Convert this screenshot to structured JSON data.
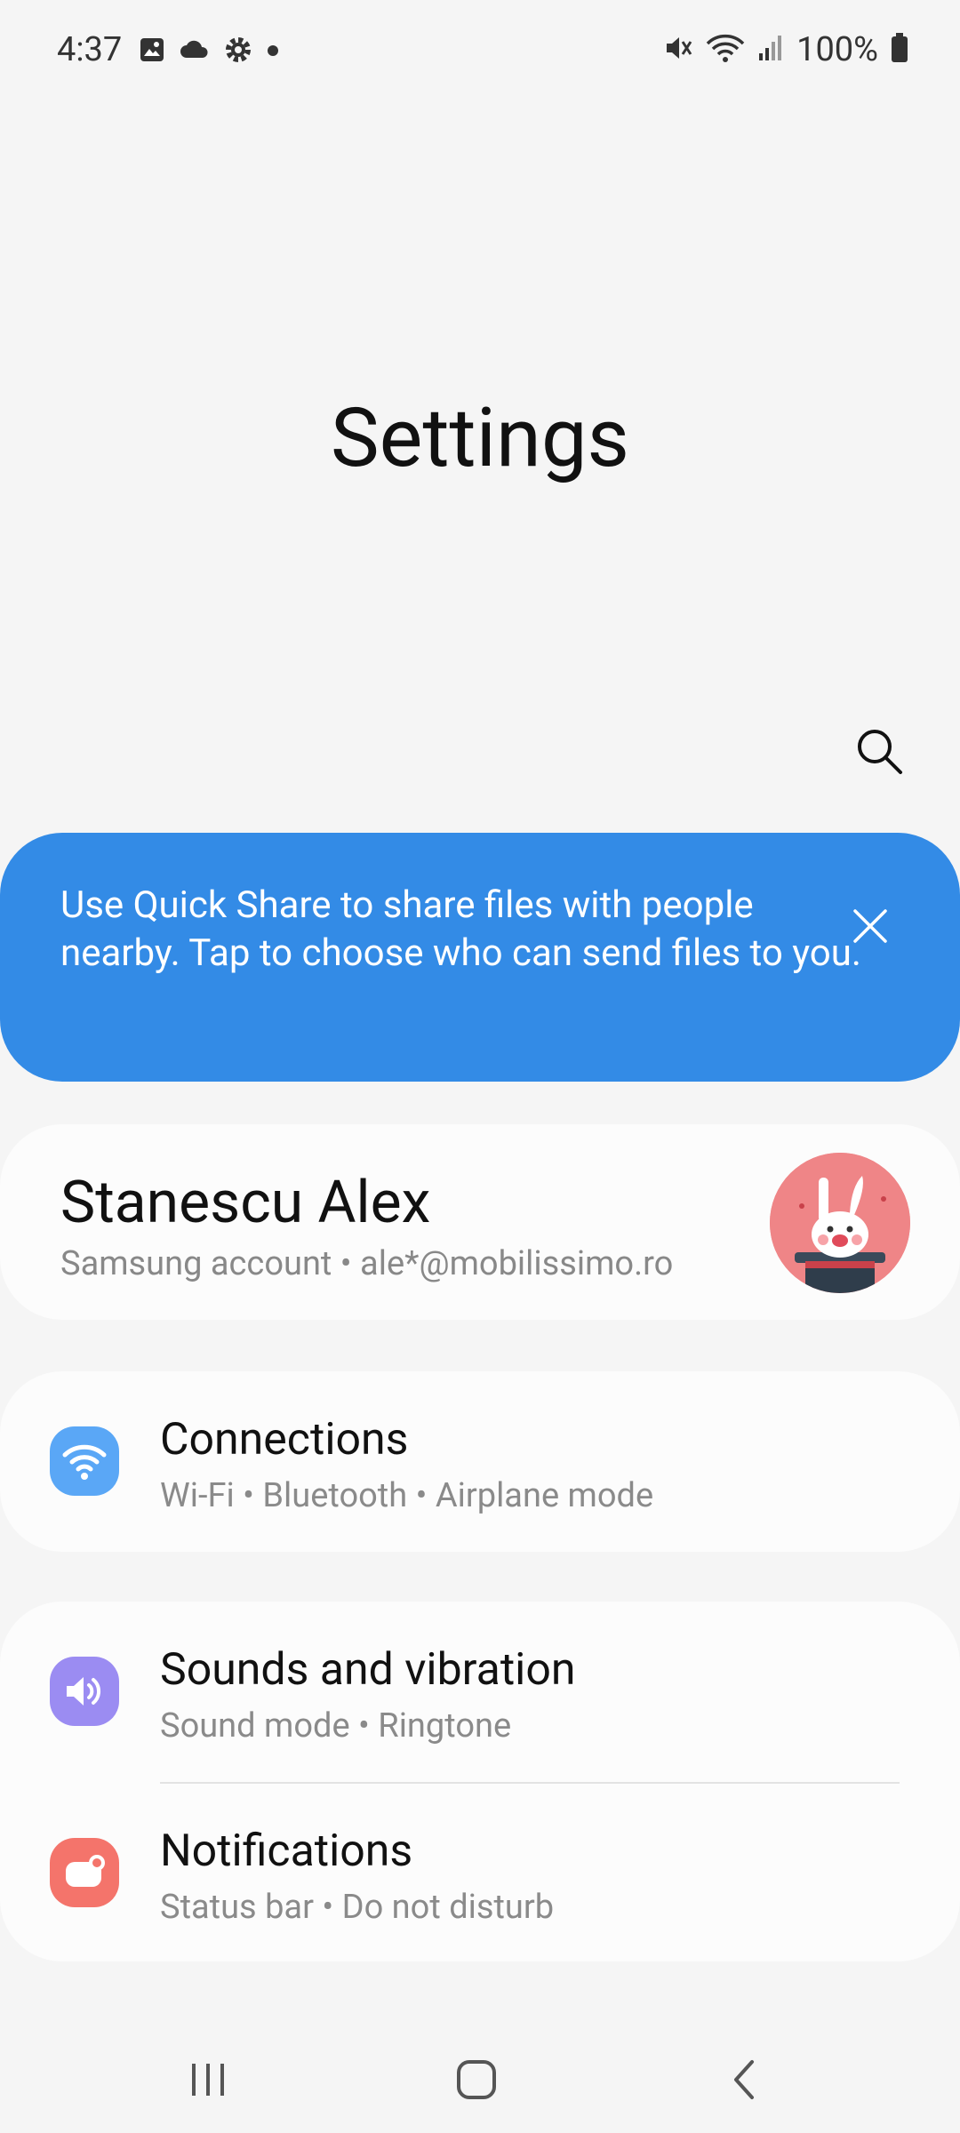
{
  "status_bar": {
    "time": "4:37",
    "battery": "100%",
    "left_icons": [
      "gallery-icon",
      "cloud-icon",
      "settings-gear-icon",
      "dot-icon"
    ],
    "right_icons": [
      "mute-icon",
      "wifi-icon",
      "signal-icon",
      "battery-icon"
    ]
  },
  "header": {
    "title": "Settings"
  },
  "banner": {
    "text": "Use Quick Share to share files with people nearby. Tap to choose who can send files to you.",
    "color": "#338be6"
  },
  "account": {
    "name": "Stanescu Alex",
    "subtitle": "Samsung account  •  ale*@mobilissimo.ro"
  },
  "settings_items": [
    {
      "title": "Connections",
      "subtitle": "Wi-Fi  •  Bluetooth  •  Airplane mode",
      "icon": "wifi-icon",
      "icon_color": "#5aa7f6"
    },
    {
      "title": "Sounds and vibration",
      "subtitle": "Sound mode  •  Ringtone",
      "icon": "volume-icon",
      "icon_color": "#9b8cf2"
    },
    {
      "title": "Notifications",
      "subtitle": "Status bar  •  Do not disturb",
      "icon": "notifications-icon",
      "icon_color": "#f4746b"
    }
  ],
  "nav_bar": {
    "buttons": [
      "recents-icon",
      "home-icon",
      "back-icon"
    ]
  }
}
